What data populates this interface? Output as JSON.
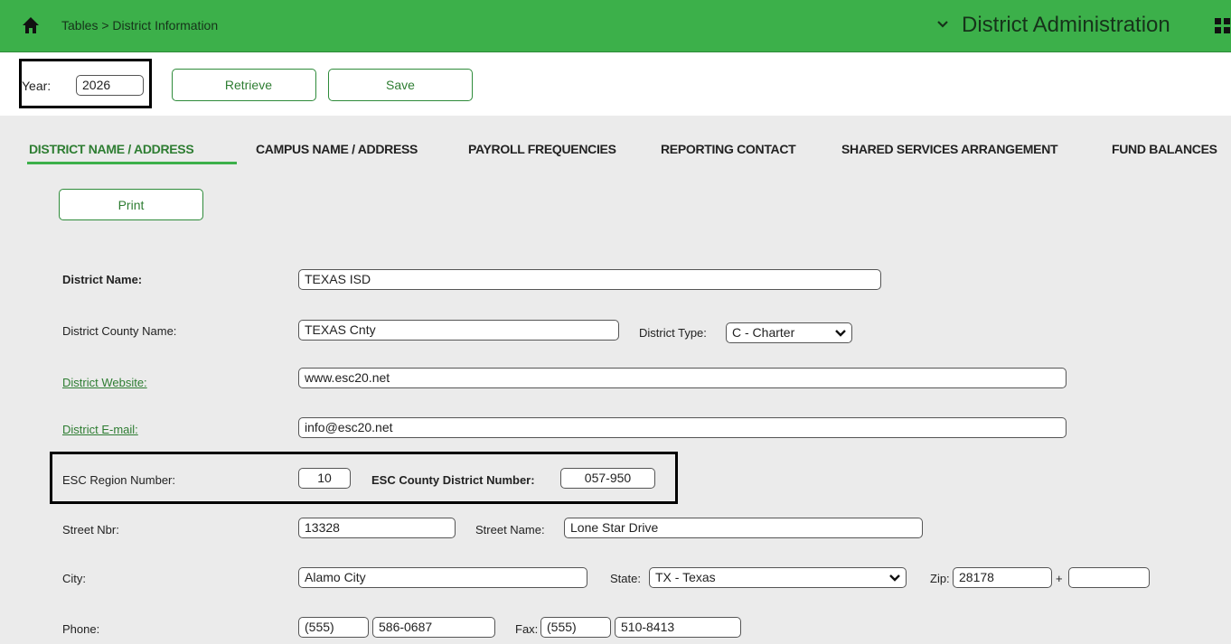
{
  "header": {
    "breadcrumb": "Tables > District Information",
    "app_title": "District Administration",
    "icons": [
      "home-icon",
      "chevron-down-icon",
      "grid-icon"
    ],
    "bar_color": "#3cb04a"
  },
  "toolbar": {
    "year_label": "Year:",
    "year_value": "2026",
    "retrieve_label": "Retrieve",
    "save_label": "Save"
  },
  "tabs": [
    {
      "label": "DISTRICT NAME / ADDRESS",
      "active": true
    },
    {
      "label": "CAMPUS NAME / ADDRESS"
    },
    {
      "label": "PAYROLL FREQUENCIES"
    },
    {
      "label": "REPORTING CONTACT"
    },
    {
      "label": "SHARED SERVICES ARRANGEMENT"
    },
    {
      "label": "FUND BALANCES"
    }
  ],
  "print_label": "Print",
  "form": {
    "district_name_label": "District Name:",
    "district_name": "TEXAS ISD",
    "county_name_label": "District County Name:",
    "county_name": "TEXAS Cnty",
    "district_type_label": "District Type:",
    "district_type": "C - Charter",
    "website_label": "District Website:",
    "website": "www.esc20.net",
    "email_label": "District E-mail:",
    "email": "info@esc20.net",
    "esc_region_label": "ESC Region Number:",
    "esc_region": "10",
    "esc_county_label": "ESC County District Number:",
    "esc_county": "057-950",
    "street_nbr_label": "Street Nbr:",
    "street_nbr": "13328",
    "street_name_label": "Street Name:",
    "street_name": "Lone Star Drive",
    "city_label": "City:",
    "city": "Alamo City",
    "state_label": "State:",
    "state": "TX - Texas",
    "zip_label": "Zip:",
    "zip": "28178",
    "zip_plus": "+",
    "zip_ext": "",
    "phone_label": "Phone:",
    "phone_area": "(555)",
    "phone_number": "586-0687",
    "fax_label": "Fax:",
    "fax_area": "(555)",
    "fax_number": "510-8413"
  },
  "accent_color": "#2e7d32"
}
